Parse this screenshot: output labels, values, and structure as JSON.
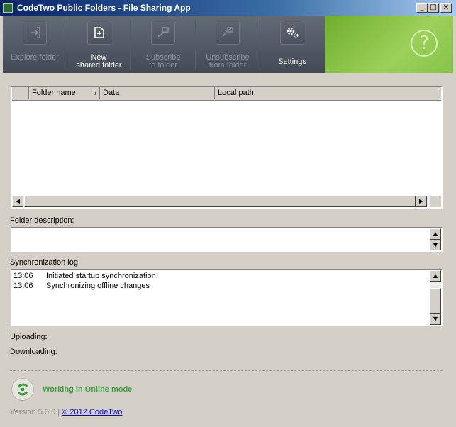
{
  "window": {
    "title": "CodeTwo Public Folders - File Sharing App",
    "controls": {
      "minimize": "_",
      "maximize": "□",
      "close": "✕"
    }
  },
  "toolbar": {
    "buttons": [
      {
        "line1": "Explore folder",
        "line2": "",
        "enabled": false,
        "icon": "explore-folder-icon"
      },
      {
        "line1": "New",
        "line2": "shared folder",
        "enabled": true,
        "icon": "new-shared-folder-icon"
      },
      {
        "line1": "Subscribe",
        "line2": "to folder",
        "enabled": false,
        "icon": "subscribe-icon"
      },
      {
        "line1": "Unsubscribe",
        "line2": "from folder",
        "enabled": false,
        "icon": "unsubscribe-icon"
      },
      {
        "line1": "Settings",
        "line2": "",
        "enabled": true,
        "icon": "gear-icon"
      }
    ],
    "help_glyph": "?"
  },
  "folders_table": {
    "columns": [
      "Folder name",
      "Data",
      "Local path"
    ],
    "sort_indicator": "/",
    "rows": []
  },
  "folder_description": {
    "label": "Folder description:",
    "value": ""
  },
  "sync_log": {
    "label": "Synchronization log:",
    "entries": [
      {
        "time": "13:06",
        "message": "Initiated startup synchronization."
      },
      {
        "time": "13:06",
        "message": "Synchronizing offline changes"
      }
    ]
  },
  "transfer": {
    "uploading_label": "Uploading:",
    "downloading_label": "Downloading:"
  },
  "status": {
    "text": "Working in Online mode",
    "color": "#3aa13a"
  },
  "footer": {
    "version": "Version 5.0.0",
    "separator": "|",
    "copyright": "© 2012 CodeTwo"
  },
  "colors": {
    "toolbar_bg": "#4b525d",
    "help_bg": "#86c44a",
    "title_bar": "#0a246a"
  }
}
